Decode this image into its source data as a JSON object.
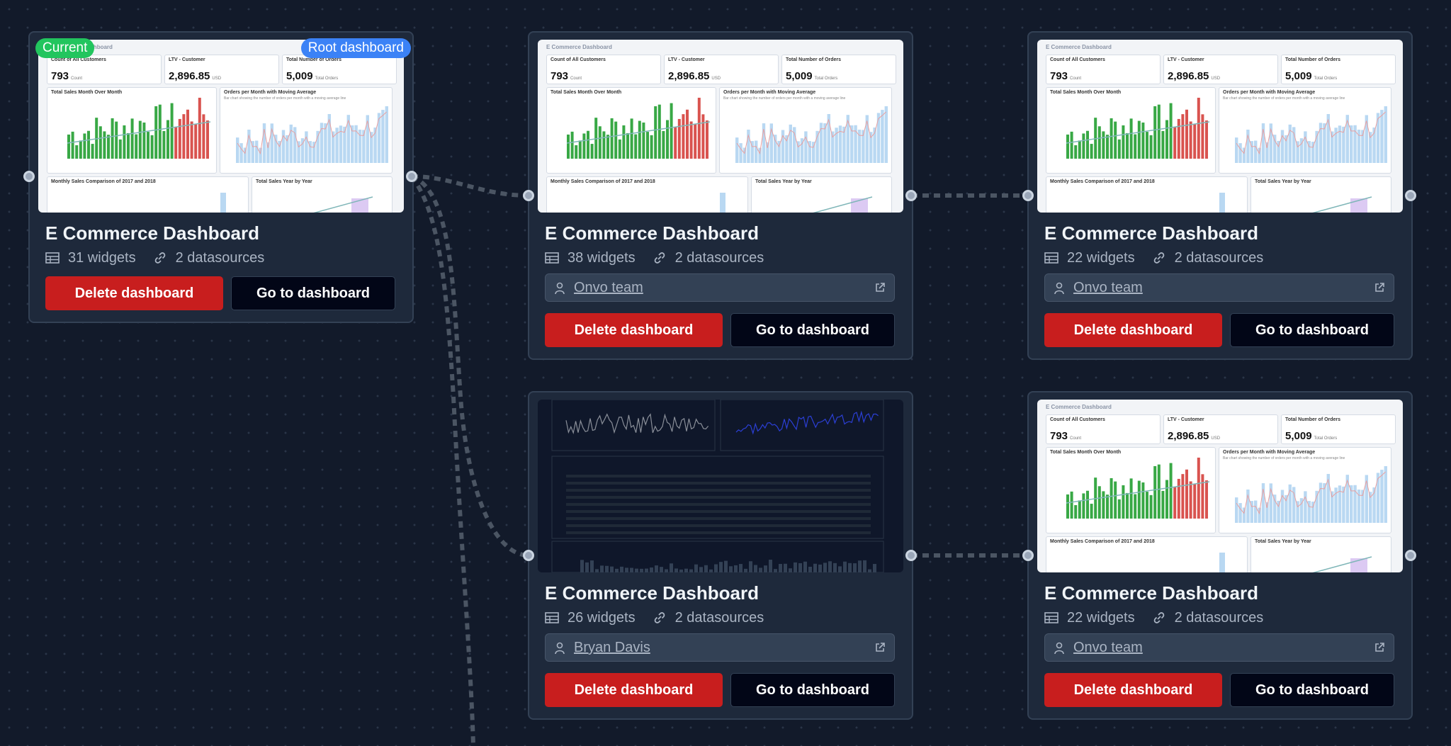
{
  "colors": {
    "canvas": "#121a2a",
    "card": "#1e293b",
    "delete": "#c81e1e",
    "current_badge": "#22c55e",
    "root_badge": "#3b82f6",
    "edge": "#4b5563"
  },
  "common": {
    "title": "E Commerce Dashboard",
    "delete_label": "Delete dashboard",
    "go_label": "Go to dashboard",
    "datasources": "2 datasources",
    "preview_title": "E Commerce Dashboard",
    "kpis": [
      {
        "label": "Count of All Customers",
        "value": "793",
        "unit": "Count"
      },
      {
        "label": "LTV - Customer",
        "value": "2,896.85",
        "unit": "USD"
      },
      {
        "label": "Total Number of Orders",
        "value": "5,009",
        "unit": "Total Orders"
      }
    ],
    "charts": {
      "sales_month": "Total Sales Month Over Month",
      "orders_avg": "Orders per Month with Moving Average",
      "orders_avg_sub": "Bar chart showing the number of orders per month with a moving average line",
      "monthly_compare": "Monthly Sales Comparison of 2017 and 2018",
      "sales_year": "Total Sales Year by Year"
    }
  },
  "badges": {
    "current": "Current",
    "root": "Root dashboard"
  },
  "cards": [
    {
      "widgets": "31 widgets"
    },
    {
      "widgets": "38 widgets",
      "owner": "Onvo team"
    },
    {
      "widgets": "22 widgets",
      "owner": "Onvo team"
    },
    {
      "widgets": "26 widgets",
      "owner": "Bryan Davis"
    },
    {
      "widgets": "22 widgets",
      "owner": "Onvo team"
    }
  ]
}
